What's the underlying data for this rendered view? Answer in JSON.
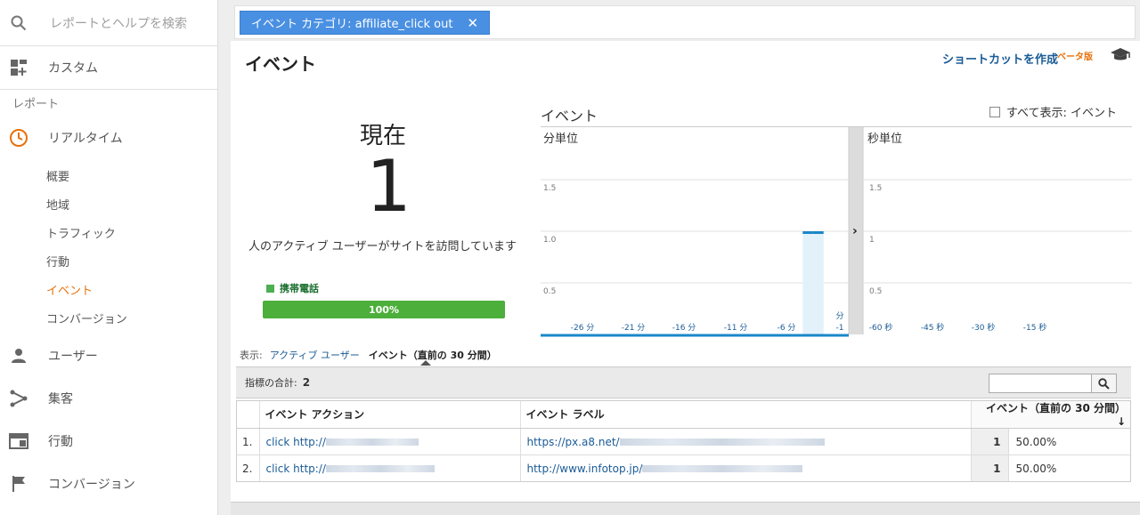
{
  "sidebar": {
    "search_label": "レポートとヘルプを検索",
    "custom_label": "カスタム",
    "reports_section": "レポート",
    "realtime_label": "リアルタイム",
    "realtime_items": [
      "概要",
      "地域",
      "トラフィック",
      "行動",
      "イベント",
      "コンバージョン"
    ],
    "active_item": "イベント",
    "audience_label": "ユーザー",
    "acquisition_label": "集客",
    "behavior_label": "行動",
    "conversion_label": "コンバージョン",
    "accent_color": "#e8710a"
  },
  "filter": {
    "chip_label": "イベント カテゴリ: affiliate_click out",
    "chip_close": "✕"
  },
  "header": {
    "title": "イベント",
    "shortcut": "ショートカットを作成",
    "beta": "ベータ版"
  },
  "now": {
    "label": "現在",
    "value": "1",
    "description": "人のアクティブ ユーザーがサイトを訪問しています",
    "device_legend": "携帯電話",
    "device_pct": "100%"
  },
  "chart_section": {
    "title": "イベント",
    "show_all": "すべて表示: イベント",
    "expand_arrow": "›"
  },
  "chart_data": [
    {
      "type": "bar",
      "title": "分単位",
      "ylim": [
        0,
        1.5
      ],
      "yticks": [
        "1.5",
        "1.0",
        "0.5"
      ],
      "xticks": [
        "-26 分",
        "-21 分",
        "-16 分",
        "-11 分",
        "-6 分",
        "分"
      ],
      "xticks_extra": "-1",
      "bars": [
        {
          "minute": -4,
          "value": 1.0
        },
        {
          "minute": -3,
          "value": 1.0
        }
      ],
      "bar_color": "#1b87c9"
    },
    {
      "type": "bar",
      "title": "秒単位",
      "ylim": [
        0,
        1.5
      ],
      "yticks": [
        "1.5",
        "1",
        "0.5"
      ],
      "xticks": [
        "-60 秒",
        "-45 秒",
        "-30 秒",
        "-15 秒"
      ],
      "bars": []
    }
  ],
  "view": {
    "label": "表示:",
    "link": "アクティブ ユーザー",
    "current": "イベント（直前の 30 分間）"
  },
  "summary": {
    "label": "指標の合計:",
    "value": "2"
  },
  "table": {
    "headers": [
      "イベント アクション",
      "イベント ラベル",
      "イベント（直前の 30 分間）"
    ],
    "rows": [
      {
        "index": "1.",
        "action": "click http://",
        "label": "https://px.a8.net/",
        "count": "1",
        "pct": "50.00%"
      },
      {
        "index": "2.",
        "action": "click http://",
        "label": "http://www.infotop.jp/",
        "count": "1",
        "pct": "50.00%"
      }
    ]
  }
}
